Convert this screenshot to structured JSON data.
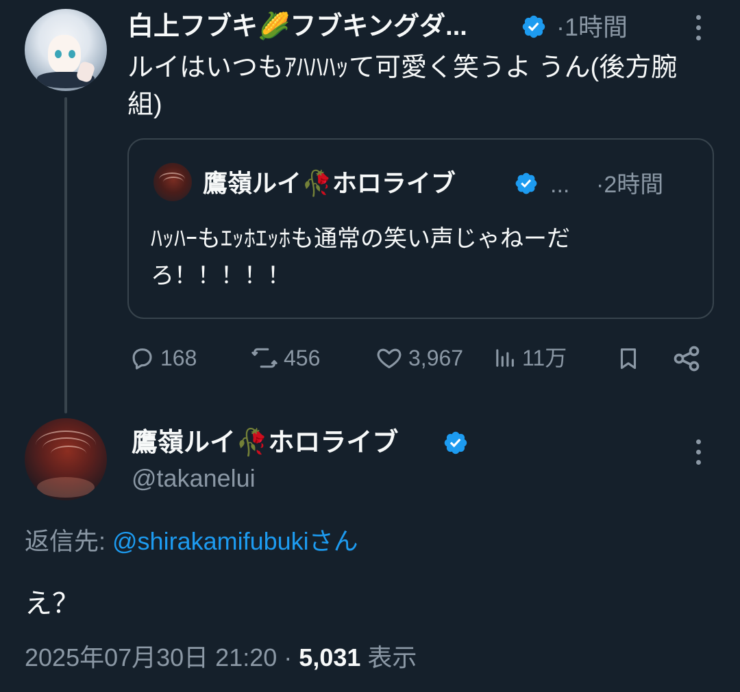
{
  "tweet_parent": {
    "author": "白上フブキ🌽フブキングダ...",
    "time": "1時間",
    "text": "ルイはいつもｱﾊﾊﾊｯて可愛く笑うよ うん(後方腕組)",
    "quote": {
      "author": "鷹嶺ルイ🥀ホロライブ",
      "ellipsis": "...",
      "time": "2時間",
      "text": "ﾊｯﾊｰもｴｯﾎｴｯﾎも通常の笑い声じゃねーだろ！！！！！"
    },
    "stats": {
      "replies": "168",
      "reposts": "456",
      "likes": "3,967",
      "views": "11万"
    }
  },
  "tweet_main": {
    "author": "鷹嶺ルイ🥀ホロライブ",
    "handle": "@takanelui",
    "reply_prefix": "返信先: ",
    "reply_to": "@shirakamifubukiさん",
    "text": "え？",
    "timestamp": "2025年07月30日 21:20",
    "dot": "·",
    "views_count": "5,031",
    "views_label": "表示"
  },
  "icons": {
    "verified": "verified-badge-icon",
    "more": "more-icon",
    "reply": "reply-icon",
    "repost": "repost-icon",
    "like": "heart-icon",
    "views": "views-icon",
    "bookmark": "bookmark-icon",
    "share": "share-icon"
  },
  "colors": {
    "background": "#15202b",
    "primary_text": "#f7f9f9",
    "secondary_text": "#8b98a5",
    "link": "#1d9bf0",
    "border": "#38444d"
  }
}
